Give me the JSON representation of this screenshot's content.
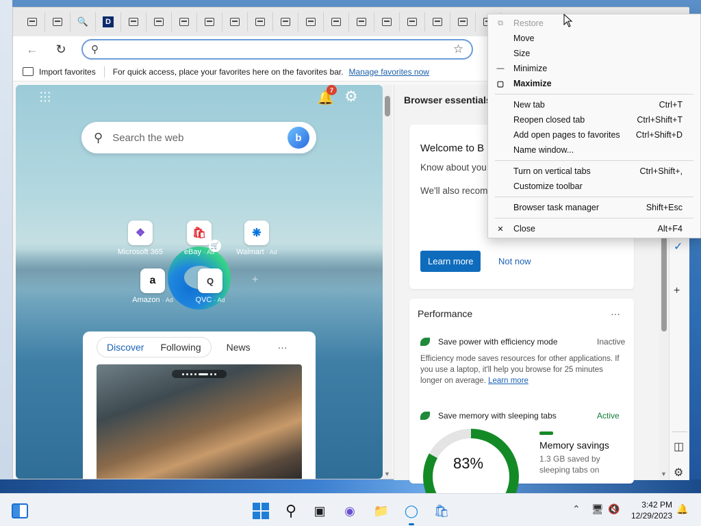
{
  "toolbar": {
    "address_value": ""
  },
  "favbar": {
    "import_label": "Import favorites",
    "hint": "For quick access, place your favorites here on the favorites bar.",
    "manage_link": "Manage favorites now"
  },
  "ntp": {
    "notification_count": "7",
    "search_placeholder": "Search the web",
    "tiles": [
      {
        "name": "Microsoft 365",
        "ad": ""
      },
      {
        "name": "eBay",
        "ad": "· Ad"
      },
      {
        "name": "Walmart",
        "ad": "· Ad"
      },
      {
        "name": "Amazon",
        "ad": "· Ad"
      },
      {
        "name": "QVC",
        "ad": "· Ad"
      }
    ],
    "feed_tabs": [
      "Discover",
      "Following"
    ],
    "feed_news": "News",
    "feed_more": "···"
  },
  "essentials": {
    "title": "Browser essentials",
    "welcome_title": "Welcome to B",
    "welcome_p1": "Know about you security in a qui",
    "welcome_p2": "We'll also recom to improve your security.",
    "learn_more": "Learn more",
    "not_now": "Not now",
    "perf_title": "Performance",
    "perf_more": "···",
    "efficiency_label": "Save power with efficiency mode",
    "efficiency_status": "Inactive",
    "efficiency_desc": "Efficiency mode saves resources for other applications. If you use a laptop, it'll help you browse for 25 minutes longer on average.",
    "efficiency_link": "Learn more",
    "sleeping_label": "Save memory with sleeping tabs",
    "sleeping_status": "Active",
    "gauge_value": "83%",
    "gauge_fraction": 0.83,
    "mem_title": "Memory savings",
    "mem_sub": "1.3 GB saved by sleeping tabs on"
  },
  "context_menu": {
    "items": [
      {
        "label": "Restore",
        "shortcut": ""
      },
      {
        "label": "Move",
        "shortcut": ""
      },
      {
        "label": "Size",
        "shortcut": ""
      },
      {
        "label": "Minimize",
        "shortcut": ""
      },
      {
        "label": "Maximize",
        "shortcut": ""
      },
      {
        "label": "New tab",
        "shortcut": "Ctrl+T"
      },
      {
        "label": "Reopen closed tab",
        "shortcut": "Ctrl+Shift+T"
      },
      {
        "label": "Add open pages to favorites",
        "shortcut": "Ctrl+Shift+D"
      },
      {
        "label": "Name window...",
        "shortcut": ""
      },
      {
        "label": "Turn on vertical tabs",
        "shortcut": "Ctrl+Shift+,"
      },
      {
        "label": "Customize toolbar",
        "shortcut": ""
      },
      {
        "label": "Browser task manager",
        "shortcut": "Shift+Esc"
      },
      {
        "label": "Close",
        "shortcut": "Alt+F4"
      }
    ]
  },
  "taskbar": {
    "time": "3:42 PM",
    "date": "12/29/2023"
  },
  "colors": {
    "accent": "#0f6cbd",
    "active_status": "#0f7b3a",
    "gauge_green": "#148a26"
  }
}
